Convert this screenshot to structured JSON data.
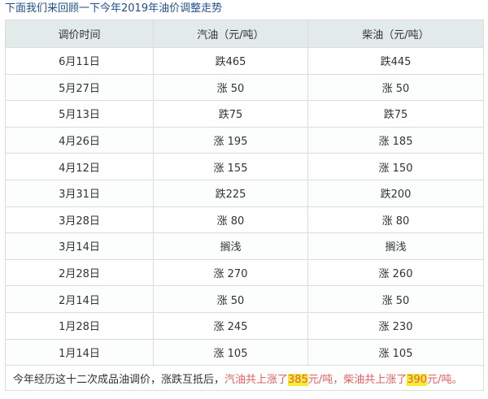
{
  "intro": "下面我们来回顾一下今年2019年油价调整走势",
  "headers": {
    "date": "调价时间",
    "gasoline": "汽油（元/吨）",
    "diesel": "柴油（元/吨）"
  },
  "rows": [
    {
      "date": "6月11日",
      "gasoline": "跌465",
      "diesel": "跌445",
      "trend": "down"
    },
    {
      "date": "5月27日",
      "gasoline": "涨 50",
      "diesel": "涨 50",
      "trend": "up"
    },
    {
      "date": "5月13日",
      "gasoline": "跌75",
      "diesel": "跌75",
      "trend": "down"
    },
    {
      "date": "4月26日",
      "gasoline": "涨 195",
      "diesel": "涨 185",
      "trend": "up"
    },
    {
      "date": "4月12日",
      "gasoline": "涨 155",
      "diesel": "涨 150",
      "trend": "up"
    },
    {
      "date": "3月31日",
      "gasoline": "跌225",
      "diesel": "跌200",
      "trend": "down"
    },
    {
      "date": "3月28日",
      "gasoline": "涨 80",
      "diesel": "涨 80",
      "trend": "up"
    },
    {
      "date": "3月14日",
      "gasoline": "搁浅",
      "diesel": "搁浅",
      "trend": "flat"
    },
    {
      "date": "2月28日",
      "gasoline": "涨 270",
      "diesel": "涨 260",
      "trend": "up"
    },
    {
      "date": "2月14日",
      "gasoline": "涨 50",
      "diesel": "涨 50",
      "trend": "up"
    },
    {
      "date": "1月28日",
      "gasoline": "涨 245",
      "diesel": "涨 230",
      "trend": "up"
    },
    {
      "date": "1月14日",
      "gasoline": "涨 105",
      "diesel": "涨 105",
      "trend": "up"
    }
  ],
  "summary": {
    "prefix": "今年经历这十二次成品油调价，涨跌互抵后，",
    "gas_label": "汽油共上涨了",
    "gas_value": "385",
    "gas_unit": "元/吨，",
    "diesel_label": "柴油共上涨了",
    "diesel_value": "390",
    "diesel_unit": "元/吨。"
  },
  "colors": {
    "up": "#e35d5d",
    "down": "#2f6ed4",
    "flat": "#3c8a25",
    "header_bg": "#e3eaea",
    "title": "#1f4e8c",
    "highlight": "#f6ed2e"
  }
}
